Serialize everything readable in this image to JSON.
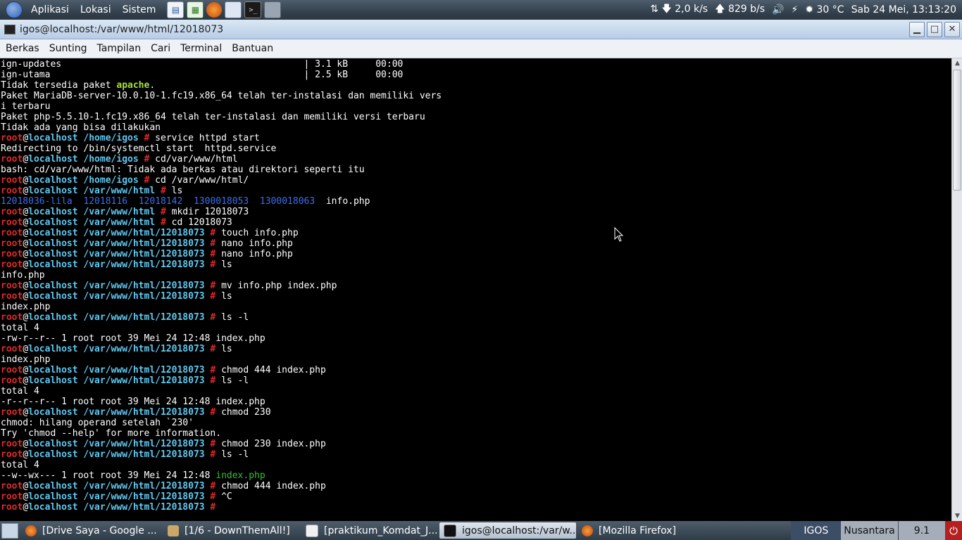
{
  "top_panel": {
    "menus": [
      "Aplikasi",
      "Lokasi",
      "Sistem"
    ],
    "net_down": "2,0 k/s",
    "net_up": "829 b/s",
    "temperature": "30 °C",
    "clock": "Sab 24 Mei, 13:13:20"
  },
  "window": {
    "title": "igos@localhost:/var/www/html/12018073",
    "menu": [
      "Berkas",
      "Sunting",
      "Tampilan",
      "Cari",
      "Terminal",
      "Bantuan"
    ]
  },
  "terminal": {
    "lines": [
      [
        [
          "ign-updates                                            | 3.1 kB     00:00",
          ""
        ]
      ],
      [
        [
          "ign-utama                                              | 2.5 kB     00:00",
          ""
        ]
      ],
      [
        [
          "Tidak tersedia paket ",
          ""
        ],
        [
          "apache",
          "pkg"
        ],
        [
          ".",
          ""
        ]
      ],
      [
        [
          "Paket MariaDB-server-10.0.10-1.fc19.x86_64 telah ter-instalasi dan memiliki vers",
          ""
        ]
      ],
      [
        [
          "i terbaru",
          ""
        ]
      ],
      [
        [
          "Paket php-5.5.10-1.fc19.x86_64 telah ter-instalasi dan memiliki versi terbaru",
          ""
        ]
      ],
      [
        [
          "Tidak ada yang bisa dilakukan",
          ""
        ]
      ],
      [
        [
          "root",
          "u"
        ],
        [
          "@",
          ""
        ],
        [
          "localhost /home/igos",
          "h"
        ],
        [
          " # ",
          "p"
        ],
        [
          "service httpd start",
          ""
        ]
      ],
      [
        [
          "Redirecting to /bin/systemctl start  httpd.service",
          ""
        ]
      ],
      [
        [
          "root",
          "u"
        ],
        [
          "@",
          ""
        ],
        [
          "localhost /home/igos",
          "h"
        ],
        [
          " # ",
          "p"
        ],
        [
          "cd/var/www/html",
          ""
        ]
      ],
      [
        [
          "bash: cd/var/www/html: Tidak ada berkas atau direktori seperti itu",
          ""
        ]
      ],
      [
        [
          "root",
          "u"
        ],
        [
          "@",
          ""
        ],
        [
          "localhost /home/igos",
          "h"
        ],
        [
          " # ",
          "p"
        ],
        [
          "cd /var/www/html/",
          ""
        ]
      ],
      [
        [
          "root",
          "u"
        ],
        [
          "@",
          ""
        ],
        [
          "localhost /var/www/html",
          "h"
        ],
        [
          " # ",
          "p"
        ],
        [
          "ls",
          ""
        ]
      ],
      [
        [
          "12018036-lila",
          "dir"
        ],
        [
          "  ",
          ""
        ],
        [
          "12018116",
          "dir"
        ],
        [
          "  ",
          ""
        ],
        [
          "12018142",
          "dir"
        ],
        [
          "  ",
          ""
        ],
        [
          "1300018053",
          "dir"
        ],
        [
          "  ",
          ""
        ],
        [
          "1300018063",
          "dir"
        ],
        [
          "  info.php",
          ""
        ]
      ],
      [
        [
          "root",
          "u"
        ],
        [
          "@",
          ""
        ],
        [
          "localhost /var/www/html",
          "h"
        ],
        [
          " # ",
          "p"
        ],
        [
          "mkdir 12018073",
          ""
        ]
      ],
      [
        [
          "root",
          "u"
        ],
        [
          "@",
          ""
        ],
        [
          "localhost /var/www/html",
          "h"
        ],
        [
          " # ",
          "p"
        ],
        [
          "cd 12018073",
          ""
        ]
      ],
      [
        [
          "root",
          "u"
        ],
        [
          "@",
          ""
        ],
        [
          "localhost /var/www/html/12018073",
          "h"
        ],
        [
          " # ",
          "p"
        ],
        [
          "touch info.php",
          ""
        ]
      ],
      [
        [
          "root",
          "u"
        ],
        [
          "@",
          ""
        ],
        [
          "localhost /var/www/html/12018073",
          "h"
        ],
        [
          " # ",
          "p"
        ],
        [
          "nano info.php",
          ""
        ]
      ],
      [
        [
          "root",
          "u"
        ],
        [
          "@",
          ""
        ],
        [
          "localhost /var/www/html/12018073",
          "h"
        ],
        [
          " # ",
          "p"
        ],
        [
          "nano info.php",
          ""
        ]
      ],
      [
        [
          "root",
          "u"
        ],
        [
          "@",
          ""
        ],
        [
          "localhost /var/www/html/12018073",
          "h"
        ],
        [
          " # ",
          "p"
        ],
        [
          "ls",
          ""
        ]
      ],
      [
        [
          "info.php",
          ""
        ]
      ],
      [
        [
          "root",
          "u"
        ],
        [
          "@",
          ""
        ],
        [
          "localhost /var/www/html/12018073",
          "h"
        ],
        [
          " # ",
          "p"
        ],
        [
          "mv info.php index.php",
          ""
        ]
      ],
      [
        [
          "root",
          "u"
        ],
        [
          "@",
          ""
        ],
        [
          "localhost /var/www/html/12018073",
          "h"
        ],
        [
          " # ",
          "p"
        ],
        [
          "ls",
          ""
        ]
      ],
      [
        [
          "index.php",
          ""
        ]
      ],
      [
        [
          "root",
          "u"
        ],
        [
          "@",
          ""
        ],
        [
          "localhost /var/www/html/12018073",
          "h"
        ],
        [
          " # ",
          "p"
        ],
        [
          "ls -l",
          ""
        ]
      ],
      [
        [
          "total 4",
          ""
        ]
      ],
      [
        [
          "-rw-r--r-- 1 root root 39 Mei 24 12:48 index.php",
          ""
        ]
      ],
      [
        [
          "root",
          "u"
        ],
        [
          "@",
          ""
        ],
        [
          "localhost /var/www/html/12018073",
          "h"
        ],
        [
          " # ",
          "p"
        ],
        [
          "ls",
          ""
        ]
      ],
      [
        [
          "index.php",
          ""
        ]
      ],
      [
        [
          "root",
          "u"
        ],
        [
          "@",
          ""
        ],
        [
          "localhost /var/www/html/12018073",
          "h"
        ],
        [
          " # ",
          "p"
        ],
        [
          "chmod 444 index.php",
          ""
        ]
      ],
      [
        [
          "root",
          "u"
        ],
        [
          "@",
          ""
        ],
        [
          "localhost /var/www/html/12018073",
          "h"
        ],
        [
          " # ",
          "p"
        ],
        [
          "ls -l",
          ""
        ]
      ],
      [
        [
          "total 4",
          ""
        ]
      ],
      [
        [
          "-r--r--r-- 1 root root 39 Mei 24 12:48 index.php",
          ""
        ]
      ],
      [
        [
          "root",
          "u"
        ],
        [
          "@",
          ""
        ],
        [
          "localhost /var/www/html/12018073",
          "h"
        ],
        [
          " # ",
          "p"
        ],
        [
          "chmod 230",
          ""
        ]
      ],
      [
        [
          "chmod: hilang operand setelah `230'",
          ""
        ]
      ],
      [
        [
          "Try 'chmod --help' for more information.",
          ""
        ]
      ],
      [
        [
          "root",
          "u"
        ],
        [
          "@",
          ""
        ],
        [
          "localhost /var/www/html/12018073",
          "h"
        ],
        [
          " # ",
          "p"
        ],
        [
          "chmod 230 index.php",
          ""
        ]
      ],
      [
        [
          "root",
          "u"
        ],
        [
          "@",
          ""
        ],
        [
          "localhost /var/www/html/12018073",
          "h"
        ],
        [
          " # ",
          "p"
        ],
        [
          "ls -l",
          ""
        ]
      ],
      [
        [
          "total 4",
          ""
        ]
      ],
      [
        [
          "--w--wx--- 1 root root 39 Mei 24 12:48 ",
          ""
        ],
        [
          "index.php",
          "exe"
        ]
      ],
      [
        [
          "root",
          "u"
        ],
        [
          "@",
          ""
        ],
        [
          "localhost /var/www/html/12018073",
          "h"
        ],
        [
          " # ",
          "p"
        ],
        [
          "chmod 444 index.php",
          ""
        ]
      ],
      [
        [
          "root",
          "u"
        ],
        [
          "@",
          ""
        ],
        [
          "localhost /var/www/html/12018073",
          "h"
        ],
        [
          " # ",
          "p"
        ],
        [
          "^C",
          ""
        ]
      ],
      [
        [
          "root",
          "u"
        ],
        [
          "@",
          ""
        ],
        [
          "localhost /var/www/html/12018073",
          "h"
        ],
        [
          " # ",
          "p"
        ]
      ]
    ]
  },
  "taskbar": {
    "tasks": [
      {
        "label": "[Drive Saya - Google ...",
        "icon": "firefox-icon"
      },
      {
        "label": "[1/6 - DownThemAll!]",
        "icon": "downthemall-icon"
      },
      {
        "label": "[praktikum_Komdat_J...",
        "icon": "document-icon"
      },
      {
        "label": "igos@localhost:/var/w...",
        "icon": "terminal-icon"
      },
      {
        "label": "[Mozilla Firefox]",
        "icon": "firefox-icon"
      }
    ],
    "keyboard": "IGOS",
    "layout": "Nusantara",
    "version": "9.1"
  },
  "colors": {
    "user": "#e02a2a",
    "host": "#5ec8f0",
    "directory": "#3a6ff0",
    "executable": "#2ec32e",
    "package": "#a8e036"
  }
}
